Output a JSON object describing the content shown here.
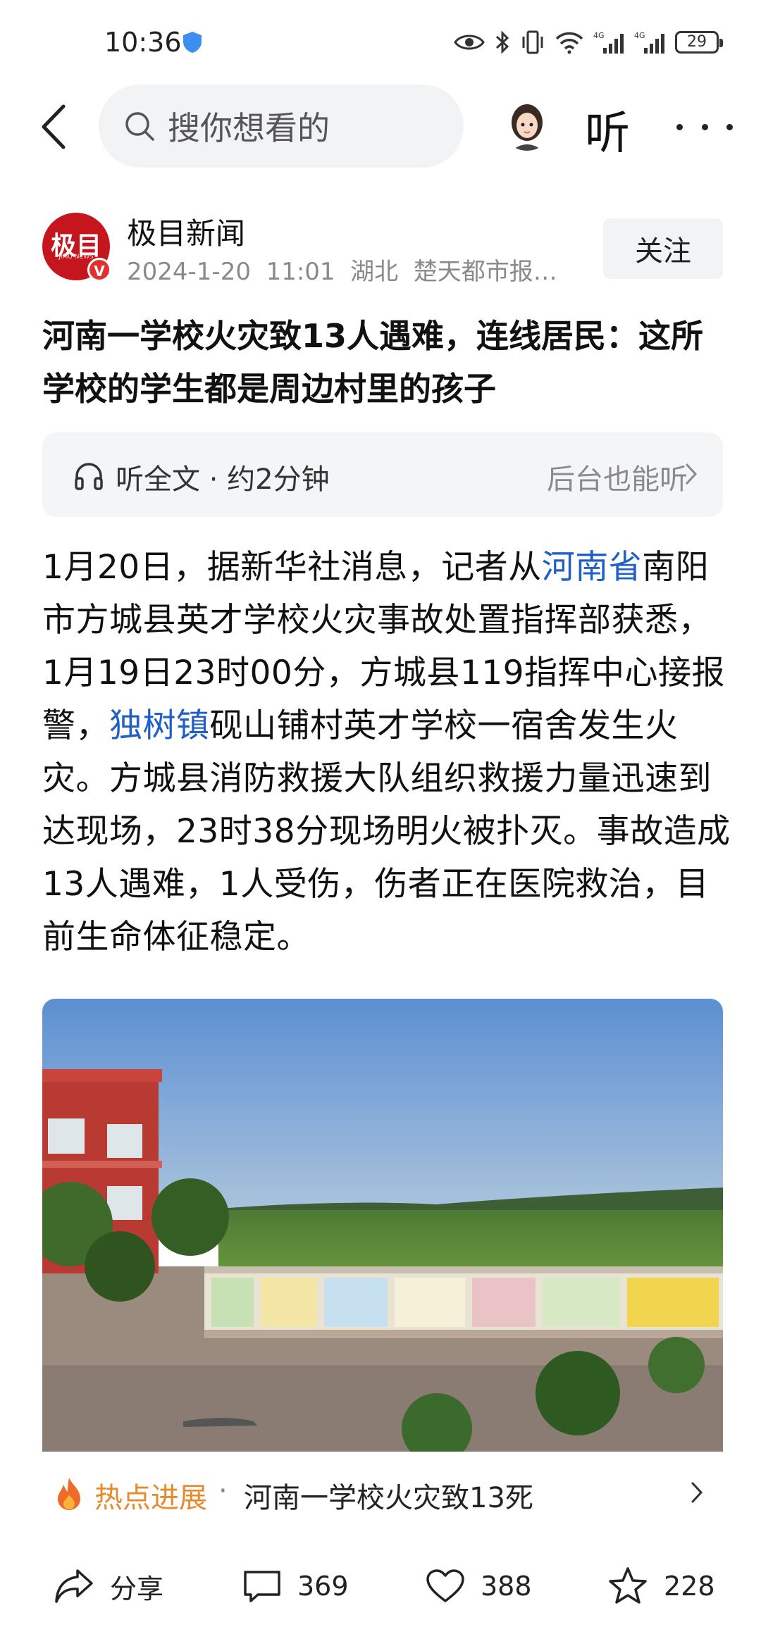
{
  "status_bar": {
    "time": "10:36",
    "battery": "29",
    "network_1": "4G",
    "network_2": "4G"
  },
  "nav": {
    "search_placeholder": "搜你想看的",
    "listen_label": "听"
  },
  "author": {
    "logo_text": "极目",
    "logo_sub": "JIMU NEWS",
    "name": "极目新闻",
    "meta": "2024-1-20  11:01  湖北  楚天都市报…",
    "follow_label": "关注"
  },
  "article": {
    "title": "河南一学校火灾致13人遇难，连线居民：这所学校的学生都是周边村里的孩子",
    "body": {
      "p1": "1月20日，据新华社消息，记者从",
      "link1": "河南省",
      "p2": "南阳市方城县英才学校火灾事故处置指挥部获悉，1月19日23时00分，方城县119指挥中心接报警，",
      "link2": "独树镇",
      "p3": "砚山铺村英才学校一宿舍发生火灾。方城县消防救援大队组织救援力量迅速到达现场，23时38分现场明火被扑灭。事故造成13人遇难，1人受伤，伤者正在医院救治，目前生命体征稳定。"
    }
  },
  "listen_bar": {
    "left": "听全文 · 约2分钟",
    "right": "后台也能听"
  },
  "hot": {
    "label": "热点进展",
    "separator": "·",
    "text": "河南一学校火灾致13死"
  },
  "actions": {
    "share_label": "分享",
    "comments": "369",
    "likes": "388",
    "favorites": "228"
  },
  "colors": {
    "link": "#1f5fc7",
    "hot": "#e8892d",
    "brand_red": "#c4161c"
  }
}
